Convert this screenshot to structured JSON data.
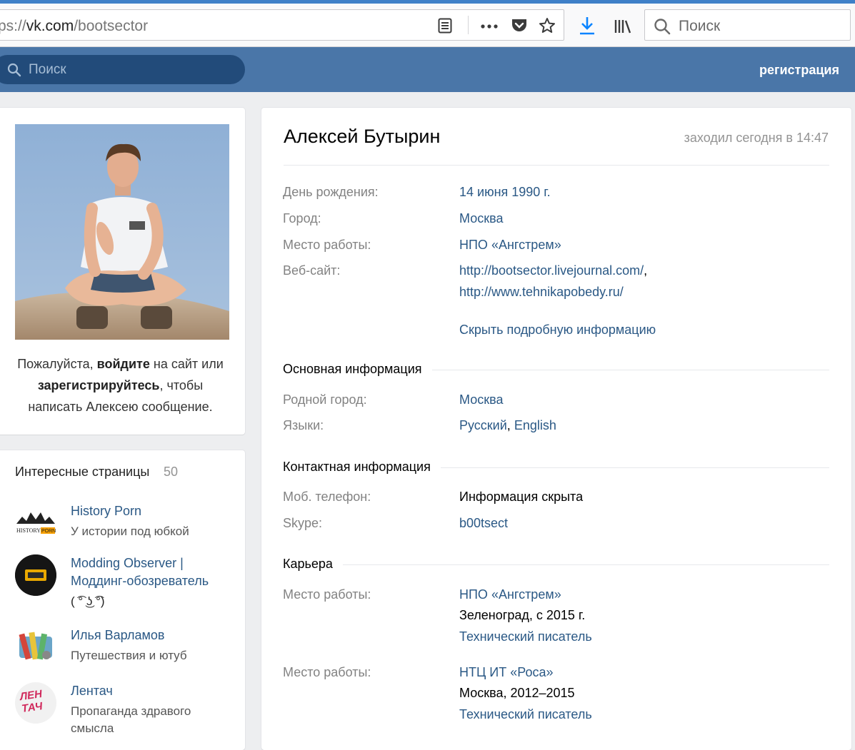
{
  "browser": {
    "url_scheme": "ps://",
    "url_host": "vk.com",
    "url_path": "/bootsector",
    "search_placeholder": "Поиск"
  },
  "vk_header": {
    "search_placeholder": "Поиск",
    "register_label": "регистрация"
  },
  "left": {
    "login_prompt": {
      "pre": "Пожалуйста, ",
      "login": "войдите",
      "mid": " на сайт или",
      "register": "зарегистрируйтесь",
      "post": ", чтобы",
      "line3": "написать Алексею сообщение."
    },
    "interesting": {
      "title": "Интересные страницы",
      "count": "50",
      "items": [
        {
          "name": "History Porn",
          "desc": "У истории под юбкой"
        },
        {
          "name": "Modding Observer |",
          "name2": "Моддинг-обозреватель",
          "desc": "( ͡° ͜ʖ ͡°)"
        },
        {
          "name": "Илья Варламов",
          "desc": "Путешествия и ютуб"
        },
        {
          "name": "Лентач",
          "desc": "Пропаганда здравого",
          "desc2": "смысла",
          "logo": "ЛЕН\nТАЧ"
        }
      ]
    }
  },
  "profile": {
    "name": "Алексей Бутырин",
    "last_seen": "заходил сегодня в 14:47",
    "short": [
      {
        "label": "День рождения:",
        "value": "14 июня 1990 г."
      },
      {
        "label": "Город:",
        "value": "Москва"
      },
      {
        "label": "Место работы:",
        "value": "НПО «Ангстрем»"
      },
      {
        "label": "Веб-сайт:",
        "value": "http://bootsector.livejournal.com/",
        "sep": ",",
        "value2": "http://www.tehnikapobedy.ru/"
      }
    ],
    "hide_link": "Скрыть подробную информацию",
    "sections": {
      "main": {
        "title": "Основная информация",
        "hometown_label": "Родной город:",
        "hometown": "Москва",
        "languages_label": "Языки:",
        "lang1": "Русский",
        "lang_sep": ",",
        "lang2": "English"
      },
      "contacts": {
        "title": "Контактная информация",
        "phone_label": "Моб. телефон:",
        "phone": "Информация скрыта",
        "skype_label": "Skype:",
        "skype": "b00tsect"
      },
      "career": {
        "title": "Карьера",
        "jobs": [
          {
            "label": "Место работы:",
            "company": "НПО «Ангстрем»",
            "place": "Зеленоград, с 2015 г.",
            "position": "Технический писатель"
          },
          {
            "label": "Место работы:",
            "company": "НТЦ ИТ «Роса»",
            "place": "Москва, 2012–2015",
            "position": "Технический писатель"
          }
        ]
      }
    }
  },
  "colors": {
    "vk_blue": "#4a76a8",
    "link": "#2a5885",
    "firefox_accent": "#0a84ff"
  }
}
